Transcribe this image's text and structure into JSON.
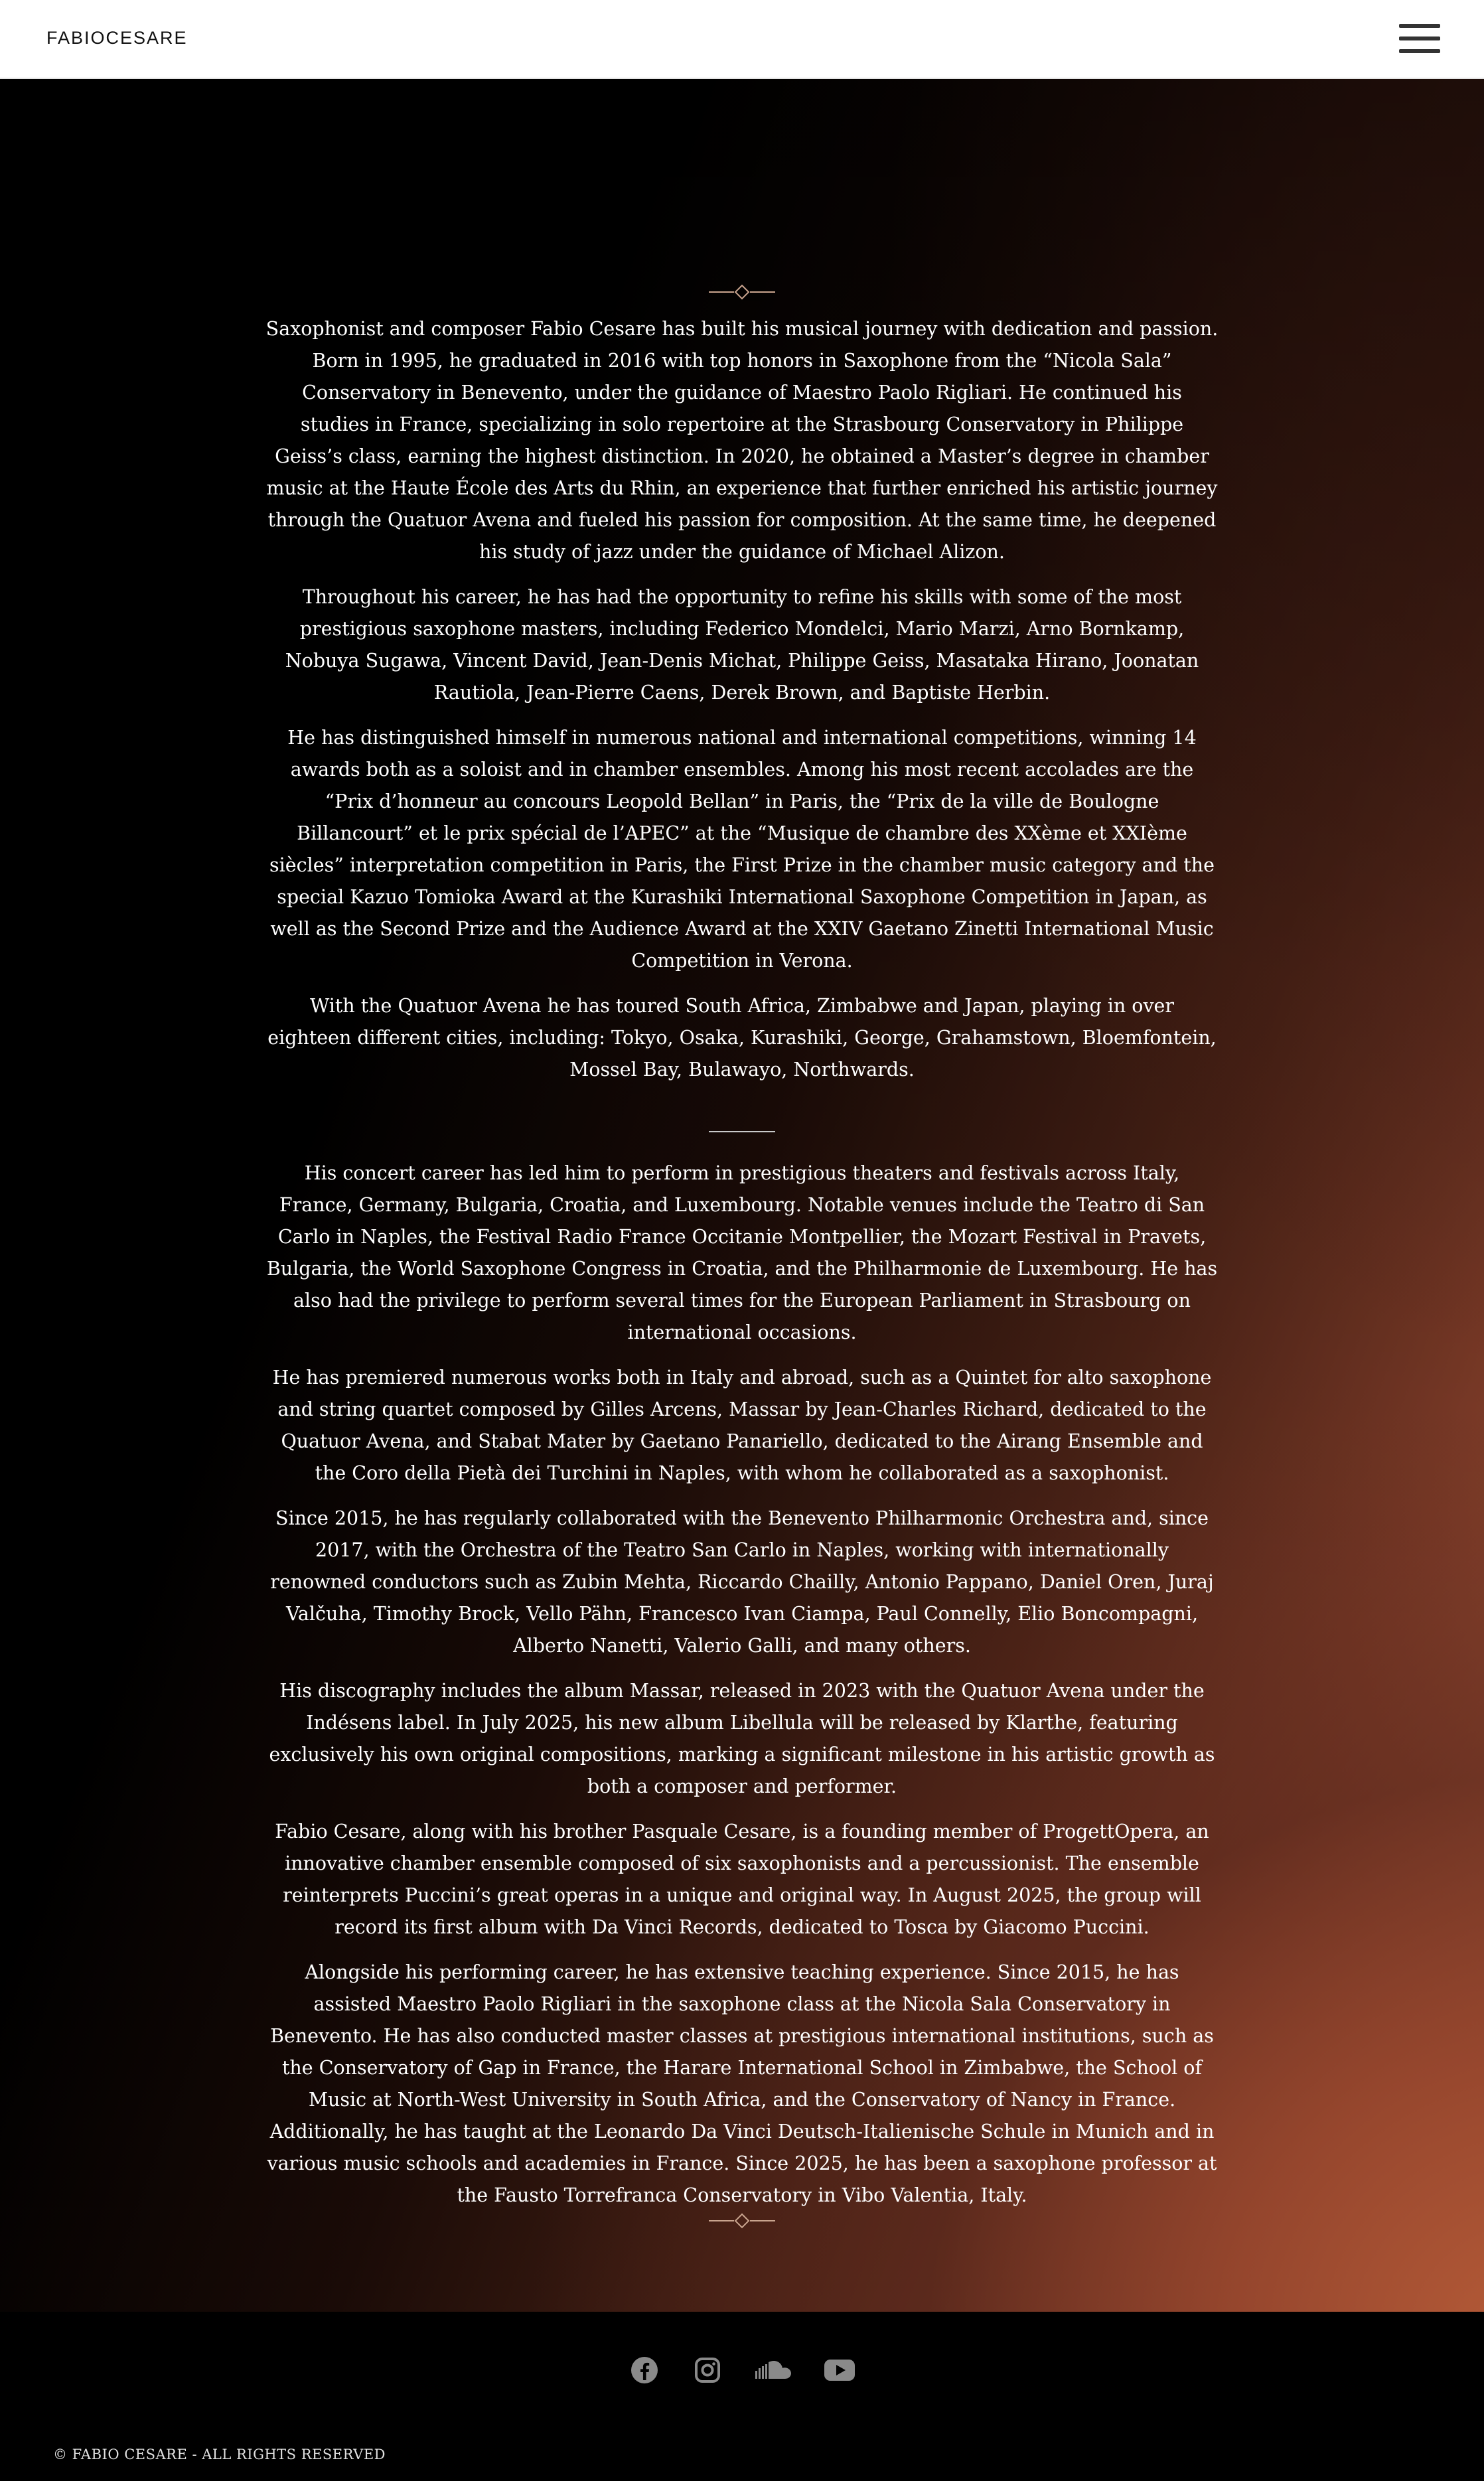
{
  "header": {
    "brand": "FABIOCESARE"
  },
  "bio": {
    "section1": [
      "Saxophonist and composer Fabio Cesare has built his musical journey with dedication and passion. Born in 1995, he graduated in 2016 with top honors in Saxophone from the “Nicola Sala” Conservatory in Benevento, under the guidance of Maestro Paolo Rigliari. He continued his studies in France, specializing in solo repertoire at the Strasbourg Conservatory in Philippe Geiss’s class, earning the highest distinction. In 2020, he obtained a Master’s degree in chamber music at the Haute École des Arts du Rhin, an experience that further enriched his artistic journey through the Quatuor Avena and fueled his passion for composition. At the same time, he deepened his study of jazz under the guidance of Michael Alizon.",
      "Throughout his career, he has had the opportunity to refine his skills with some of the most prestigious saxophone masters, including Federico Mondelci, Mario Marzi, Arno Bornkamp, Nobuya Sugawa, Vincent David, Jean-Denis Michat, Philippe Geiss, Masataka Hirano, Joonatan Rautiola, Jean-Pierre Caens, Derek Brown, and Baptiste Herbin.",
      "He has distinguished himself in numerous national and international competitions, winning 14 awards both as a soloist and in chamber ensembles. Among his most recent accolades are the “Prix d’honneur au concours Leopold Bellan” in Paris, the “Prix de la ville de Boulogne Billancourt” et le prix spécial de l’APEC” at the “Musique de chambre des XXème et XXIème siècles” interpretation competition in Paris, the First Prize in the chamber music category and the special Kazuo Tomioka Award at the Kurashiki International Saxophone Competition in Japan, as well as the Second Prize and the Audience Award at the XXIV Gaetano Zinetti International Music Competition in Verona.",
      "With the Quatuor Avena he has toured South Africa, Zimbabwe and Japan, playing in over eighteen different cities, including: Tokyo, Osaka, Kurashiki, George, Grahamstown, Bloemfontein, Mossel Bay, Bulawayo, Northwards."
    ],
    "section2": [
      "His concert career has led him to perform in prestigious theaters and festivals across Italy, France, Germany, Bulgaria, Croatia, and Luxembourg. Notable venues include the Teatro di San Carlo in Naples, the Festival Radio France Occitanie Montpellier, the Mozart Festival in Pravets, Bulgaria, the World Saxophone Congress in Croatia, and the Philharmonie de Luxembourg. He has also had the privilege to perform several times for the European Parliament in Strasbourg on international occasions.",
      "He has premiered numerous works both in Italy and abroad, such as a Quintet for alto saxophone and string quartet composed by Gilles Arcens, Massar by Jean-Charles Richard, dedicated to the Quatuor Avena, and Stabat Mater by Gaetano Panariello, dedicated to the Airang Ensemble and the Coro della Pietà dei Turchini in Naples, with whom he collaborated as a saxophonist.",
      "Since 2015, he has regularly collaborated with the Benevento Philharmonic Orchestra and, since 2017, with the Orchestra of the Teatro San Carlo in Naples, working with internationally renowned conductors such as Zubin Mehta, Riccardo Chailly, Antonio Pappano, Daniel Oren, Juraj Valčuha, Timothy Brock, Vello Pähn, Francesco Ivan Ciampa, Paul Connelly, Elio Boncompagni, Alberto Nanetti, Valerio Galli, and many others.",
      "His discography includes the album Massar, released in 2023 with the Quatuor Avena under the Indésens label. In July 2025, his new album Libellula will be released by Klarthe, featuring exclusively his own original compositions, marking a significant milestone in his artistic growth as both a composer and performer.",
      "Fabio Cesare, along with his brother Pasquale Cesare, is a founding member of ProgettOpera, an innovative chamber ensemble composed of six saxophonists and a percussionist. The ensemble reinterprets Puccini’s great operas in a unique and original way. In August 2025, the group will record its first album with Da Vinci Records, dedicated to Tosca by Giacomo Puccini.",
      "Alongside his performing career, he has extensive teaching experience. Since 2015, he has assisted Maestro Paolo Rigliari in the saxophone class at the Nicola Sala Conservatory in Benevento. He has also conducted master classes at prestigious international institutions, such as the Conservatory of Gap in France, the Harare International School in Zimbabwe, the School of Music at North-West University in South Africa, and the Conservatory of Nancy in France. Additionally, he has taught at the Leonardo Da Vinci Deutsch-Italienische Schule in Munich and in various music schools and academies in France. Since 2025, he has been a saxophone professor at the Fausto Torrefranca Conservatory in Vibo Valentia, Italy."
    ]
  },
  "footer": {
    "social": [
      "facebook-icon",
      "instagram-icon",
      "soundcloud-icon",
      "youtube-icon"
    ],
    "copyright": "© FABIO CESARE - ALL RIGHTS RESERVED"
  },
  "colors": {
    "accent": "#b05a3a",
    "ornament": "#c9a48e"
  }
}
